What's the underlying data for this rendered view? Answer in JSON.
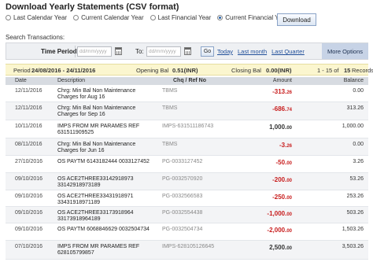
{
  "header": {
    "title": "Download Yearly Statements (CSV format)"
  },
  "periods": [
    {
      "label": "Last Calendar Year",
      "selected": false
    },
    {
      "label": "Current Calendar Year",
      "selected": false
    },
    {
      "label": "Last Financial Year",
      "selected": false
    },
    {
      "label": "Current Financial Year",
      "selected": true
    }
  ],
  "download_label": "Download",
  "search": {
    "label": "Search Transactions:",
    "time_period_label": "Time Period",
    "from_placeholder": "dd/mm/yyyy",
    "to_label": "To:",
    "to_placeholder": "dd/mm/yyyy",
    "go_label": "Go",
    "quick_links": [
      "Today",
      "Last month",
      "Last Quarter"
    ],
    "more_options_label": "More Options"
  },
  "summary": {
    "period_label": "Period",
    "period_value": "24/08/2016 - 24/11/2016",
    "opening_label": "Opening Bal",
    "opening_value": "0.51(INR)",
    "closing_label": "Closing Bal",
    "closing_value": "0.00(INR)",
    "range": "1 - 15 of",
    "total": "15",
    "records_label": "Records"
  },
  "table": {
    "headers": [
      "Date",
      "Description",
      "Chq / Ref No",
      "Amount",
      "Balance"
    ],
    "rows": [
      {
        "date": "12/11/2016",
        "desc": [
          "Chrg: Min Bal Non Maintenance",
          "Charges for Aug 16"
        ],
        "ref": "TBMS",
        "amt_int": "-313.",
        "amt_dec": "26",
        "type": "debit",
        "balance": "0.00"
      },
      {
        "date": "12/11/2016",
        "desc": [
          "Chrg: Min Bal Non Maintenance",
          "Charges for Sep 16"
        ],
        "ref": "TBMS",
        "amt_int": "-686.",
        "amt_dec": "74",
        "type": "debit",
        "balance": "313.26"
      },
      {
        "date": "10/11/2016",
        "desc": [
          "IMPS FROM MR PARAMES REF",
          "631511909525"
        ],
        "ref": "IMPS-631511186743",
        "amt_int": "1,000.",
        "amt_dec": "00",
        "type": "credit",
        "balance": "1,000.00"
      },
      {
        "date": "08/11/2016",
        "desc": [
          "Chrg: Min Bal Non Maintenance",
          "Charges for Jun 16"
        ],
        "ref": "TBMS",
        "amt_int": "-3.",
        "amt_dec": "26",
        "type": "debit",
        "balance": "0.00"
      },
      {
        "date": "27/10/2016",
        "desc": [
          "OS PAYTM 6143182444 0033127452"
        ],
        "ref": "PG-0033127452",
        "amt_int": "-50.",
        "amt_dec": "00",
        "type": "debit",
        "balance": "3.26"
      },
      {
        "date": "09/10/2016",
        "desc": [
          "OS ACE2THREE33142918973",
          "33142918973189"
        ],
        "ref": "PG-0032570920",
        "amt_int": "-200.",
        "amt_dec": "00",
        "type": "debit",
        "balance": "53.26"
      },
      {
        "date": "09/10/2016",
        "desc": [
          "OS ACE2THREE33431918971",
          "33431918971189"
        ],
        "ref": "PG-0032566583",
        "amt_int": "-250.",
        "amt_dec": "00",
        "type": "debit",
        "balance": "253.26"
      },
      {
        "date": "09/10/2016",
        "desc": [
          "OS ACE2THREE33173918964",
          "33173918964189"
        ],
        "ref": "PG-0032554438",
        "amt_int": "-1,000.",
        "amt_dec": "00",
        "type": "debit",
        "balance": "503.26"
      },
      {
        "date": "09/10/2016",
        "desc": [
          "OS PAYTM 6068846629 0032504734"
        ],
        "ref": "PG-0032504734",
        "amt_int": "-2,000.",
        "amt_dec": "00",
        "type": "debit",
        "balance": "1,503.26"
      },
      {
        "date": "07/10/2016",
        "desc": [
          "IMPS FROM MR PARAMES REF",
          "628105799857"
        ],
        "ref": "IMPS-628105126645",
        "amt_int": "2,500.",
        "amt_dec": "00",
        "type": "credit",
        "balance": "3,503.26"
      }
    ]
  }
}
